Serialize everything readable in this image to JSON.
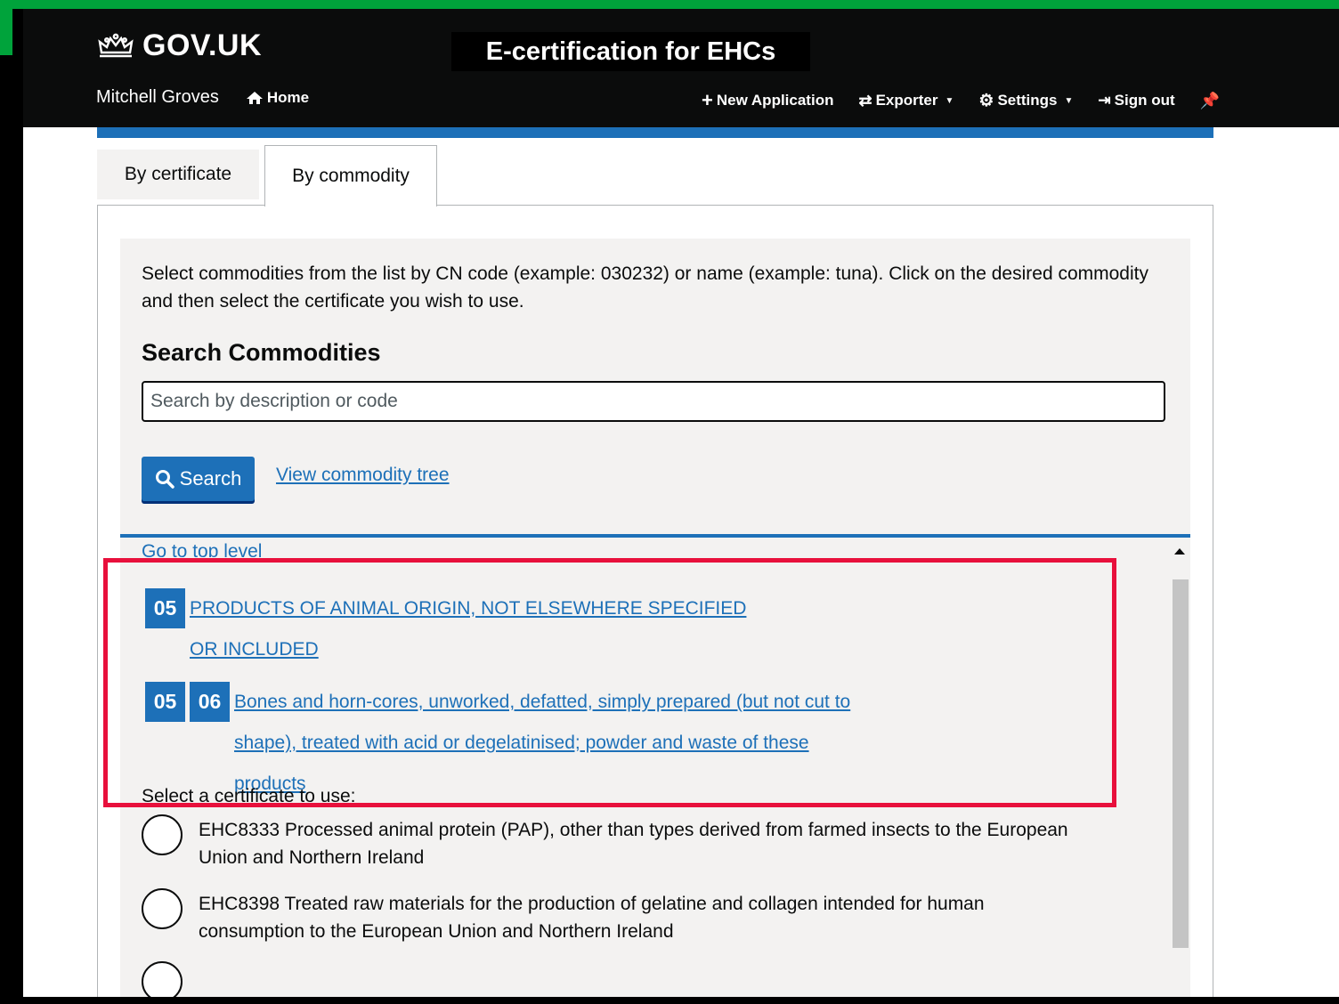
{
  "header": {
    "brand": "GOV.UK",
    "service_title": "E-certification for EHCs",
    "user_name": "Mitchell Groves",
    "home_label": "Home",
    "nav": {
      "new_application": "New Application",
      "exporter": "Exporter",
      "settings": "Settings",
      "sign_out": "Sign out"
    }
  },
  "tabs": [
    {
      "label": "By certificate",
      "active": false
    },
    {
      "label": "By commodity",
      "active": true
    }
  ],
  "intro": "Select commodities from the list by CN code (example: 030232) or name (example: tuna). Click on the desired commodity and then select the certificate you wish to use.",
  "search": {
    "heading": "Search Commodities",
    "placeholder": "Search by description or code",
    "button_label": "Search",
    "tree_link": "View commodity tree"
  },
  "tree": {
    "top_level_link": "Go to top level",
    "items": [
      {
        "codes": [
          "05"
        ],
        "label": "PRODUCTS OF ANIMAL ORIGIN, NOT ELSEWHERE SPECIFIED OR INCLUDED"
      },
      {
        "codes": [
          "05",
          "06"
        ],
        "label": "Bones and horn-cores, unworked, defatted, simply prepared (but not cut to shape), treated with acid or degelatinised; powder and waste of these products"
      }
    ]
  },
  "certificates": {
    "label": "Select a certificate to use:",
    "options": [
      "EHC8333 Processed animal protein (PAP), other than types derived from farmed insects to the European Union and Northern Ireland",
      "EHC8398 Treated raw materials for the production of gelatine and collagen intended for human consumption to the European Union and Northern Ireland"
    ]
  },
  "colors": {
    "brand_blue": "#1d70b8",
    "highlight_red": "#e8103c",
    "accent_green": "#00a33b",
    "header_black": "#0b0c0c"
  },
  "icons": [
    "crown-icon",
    "home-icon",
    "plus-icon",
    "exchange-icon",
    "gear-icon",
    "sign-out-icon",
    "pin-icon",
    "search-icon"
  ]
}
